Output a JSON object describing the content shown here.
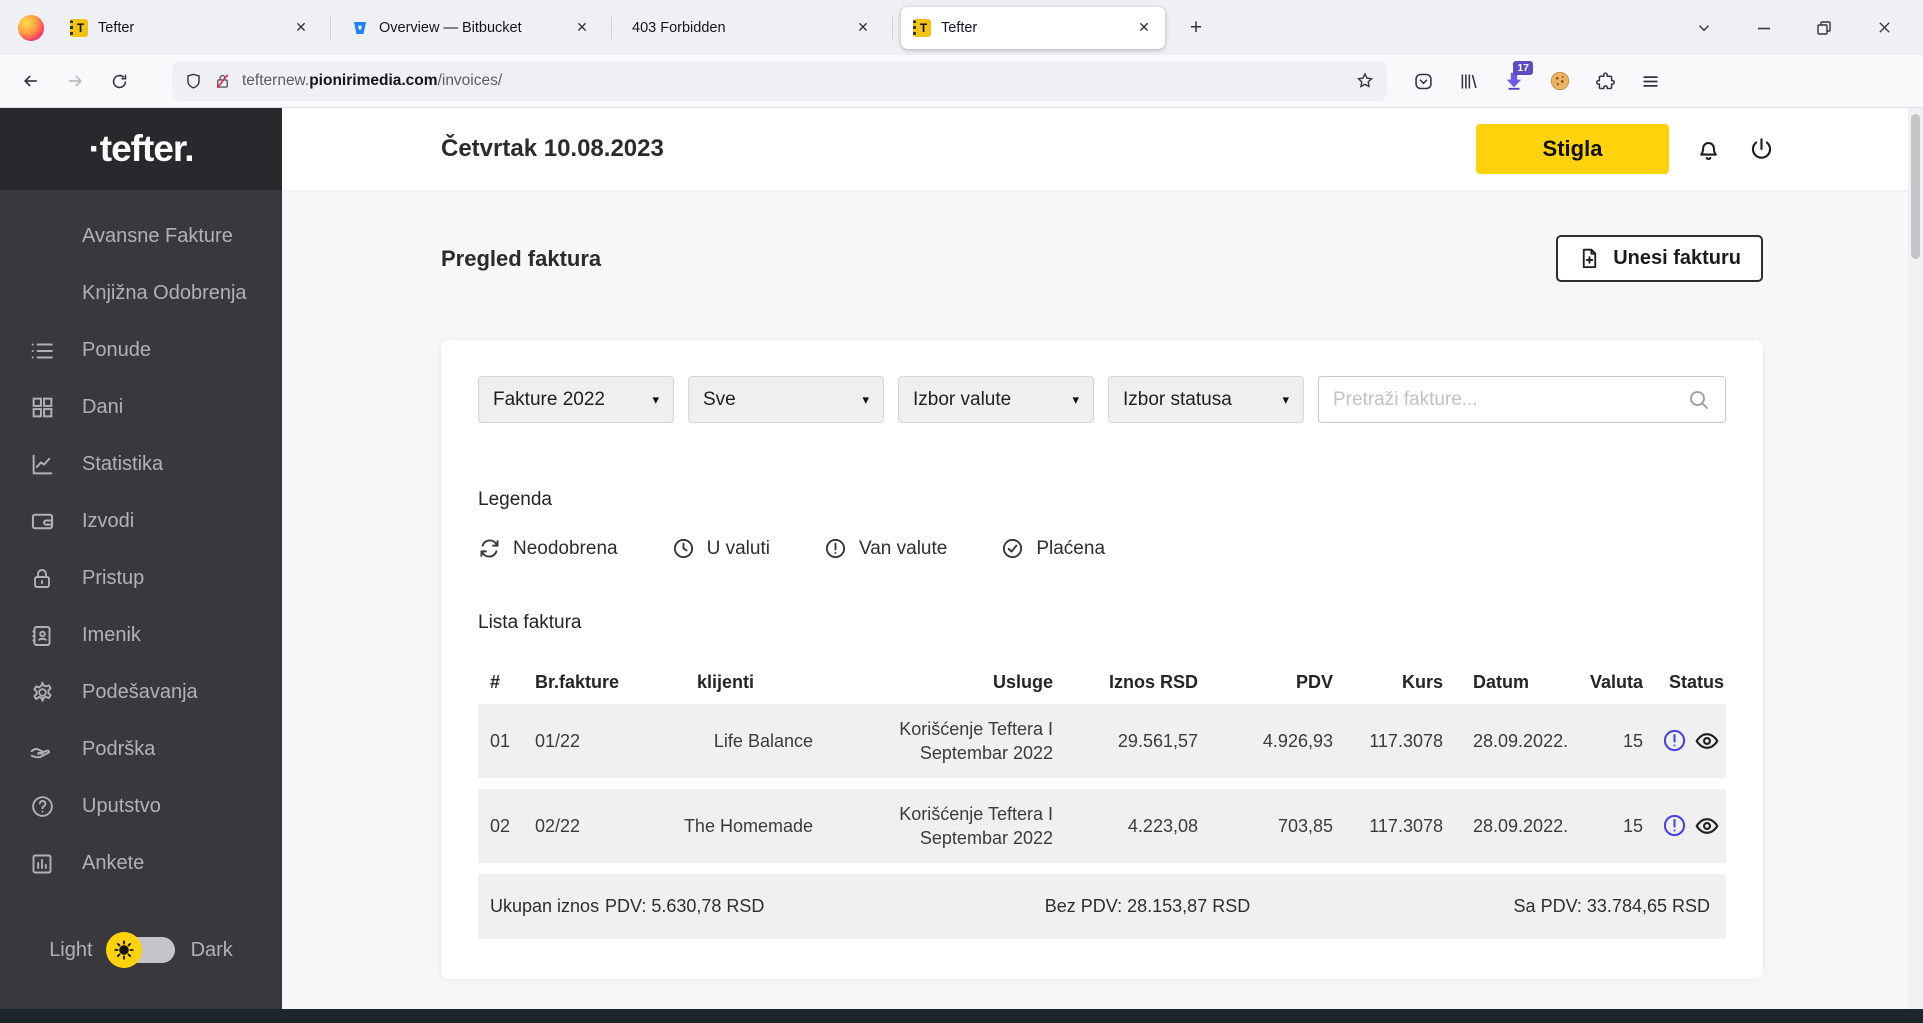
{
  "browser": {
    "tabs": [
      {
        "title": "Tefter"
      },
      {
        "title": "Overview — Bitbucket"
      },
      {
        "title": "403 Forbidden"
      },
      {
        "title": "Tefter"
      }
    ],
    "url": {
      "prefix": "tefternew.",
      "domain": "pionirimedia.com",
      "path": "/invoices/"
    },
    "extension_badge": "17"
  },
  "icons": {
    "close": "✕",
    "plus": "+",
    "caret_down": "▾",
    "tefter_favicon_letter": "T"
  },
  "sidebar": {
    "logo": "·tefter.",
    "items": [
      {
        "label": "Avansne Fakture"
      },
      {
        "label": "Knjižna Odobrenja"
      },
      {
        "label": "Ponude"
      },
      {
        "label": "Dani"
      },
      {
        "label": "Statistika"
      },
      {
        "label": "Izvodi"
      },
      {
        "label": "Pristup"
      },
      {
        "label": "Imenik"
      },
      {
        "label": "Podešavanja"
      },
      {
        "label": "Podrška"
      },
      {
        "label": "Uputstvo"
      },
      {
        "label": "Ankete"
      }
    ],
    "theme_toggle": {
      "light": "Light",
      "dark": "Dark"
    }
  },
  "header": {
    "date": "Četvrtak 10.08.2023",
    "status_button": "Stigla"
  },
  "main": {
    "title": "Pregled faktura",
    "add_button": "Unesi fakturu",
    "filters": {
      "year": "Fakture 2022",
      "type": "Sve",
      "currency": "Izbor valute",
      "status": "Izbor statusa",
      "search_placeholder": "Pretraži fakture..."
    },
    "legend": {
      "title": "Legenda",
      "items": [
        {
          "label": "Neodobrena"
        },
        {
          "label": "U valuti"
        },
        {
          "label": "Van valute"
        },
        {
          "label": "Plaćena"
        }
      ]
    },
    "table": {
      "title": "Lista faktura",
      "columns": [
        "#",
        "Br.fakture",
        "klijenti",
        "Usluge",
        "Iznos RSD",
        "PDV",
        "Kurs",
        "Datum",
        "Valuta",
        "Status"
      ],
      "rows": [
        {
          "num": "01",
          "invoice": "01/22",
          "client": "Life Balance",
          "service": "Korišćenje Teftera I Septembar 2022",
          "amount": "29.561,57",
          "pdv": "4.926,93",
          "kurs": "117.3078",
          "date": "28.09.2022.",
          "valuta": "15"
        },
        {
          "num": "02",
          "invoice": "02/22",
          "client": "The Homemade",
          "service": "Korišćenje Teftera I Septembar 2022",
          "amount": "4.223,08",
          "pdv": "703,85",
          "kurs": "117.3078",
          "date": "28.09.2022.",
          "valuta": "15"
        }
      ],
      "totals": {
        "label": "Ukupan iznos",
        "pdv": "PDV: 5.630,78 RSD",
        "bez_pdv": "Bez PDV: 28.153,87 RSD",
        "sa_pdv": "Sa PDV: 33.784,65 RSD"
      }
    }
  },
  "colors": {
    "accent_yellow": "#ffd20b",
    "status_purple": "#4b43d9",
    "sidebar_bg": "#39383d",
    "sidebar_header_bg": "#29282d"
  }
}
